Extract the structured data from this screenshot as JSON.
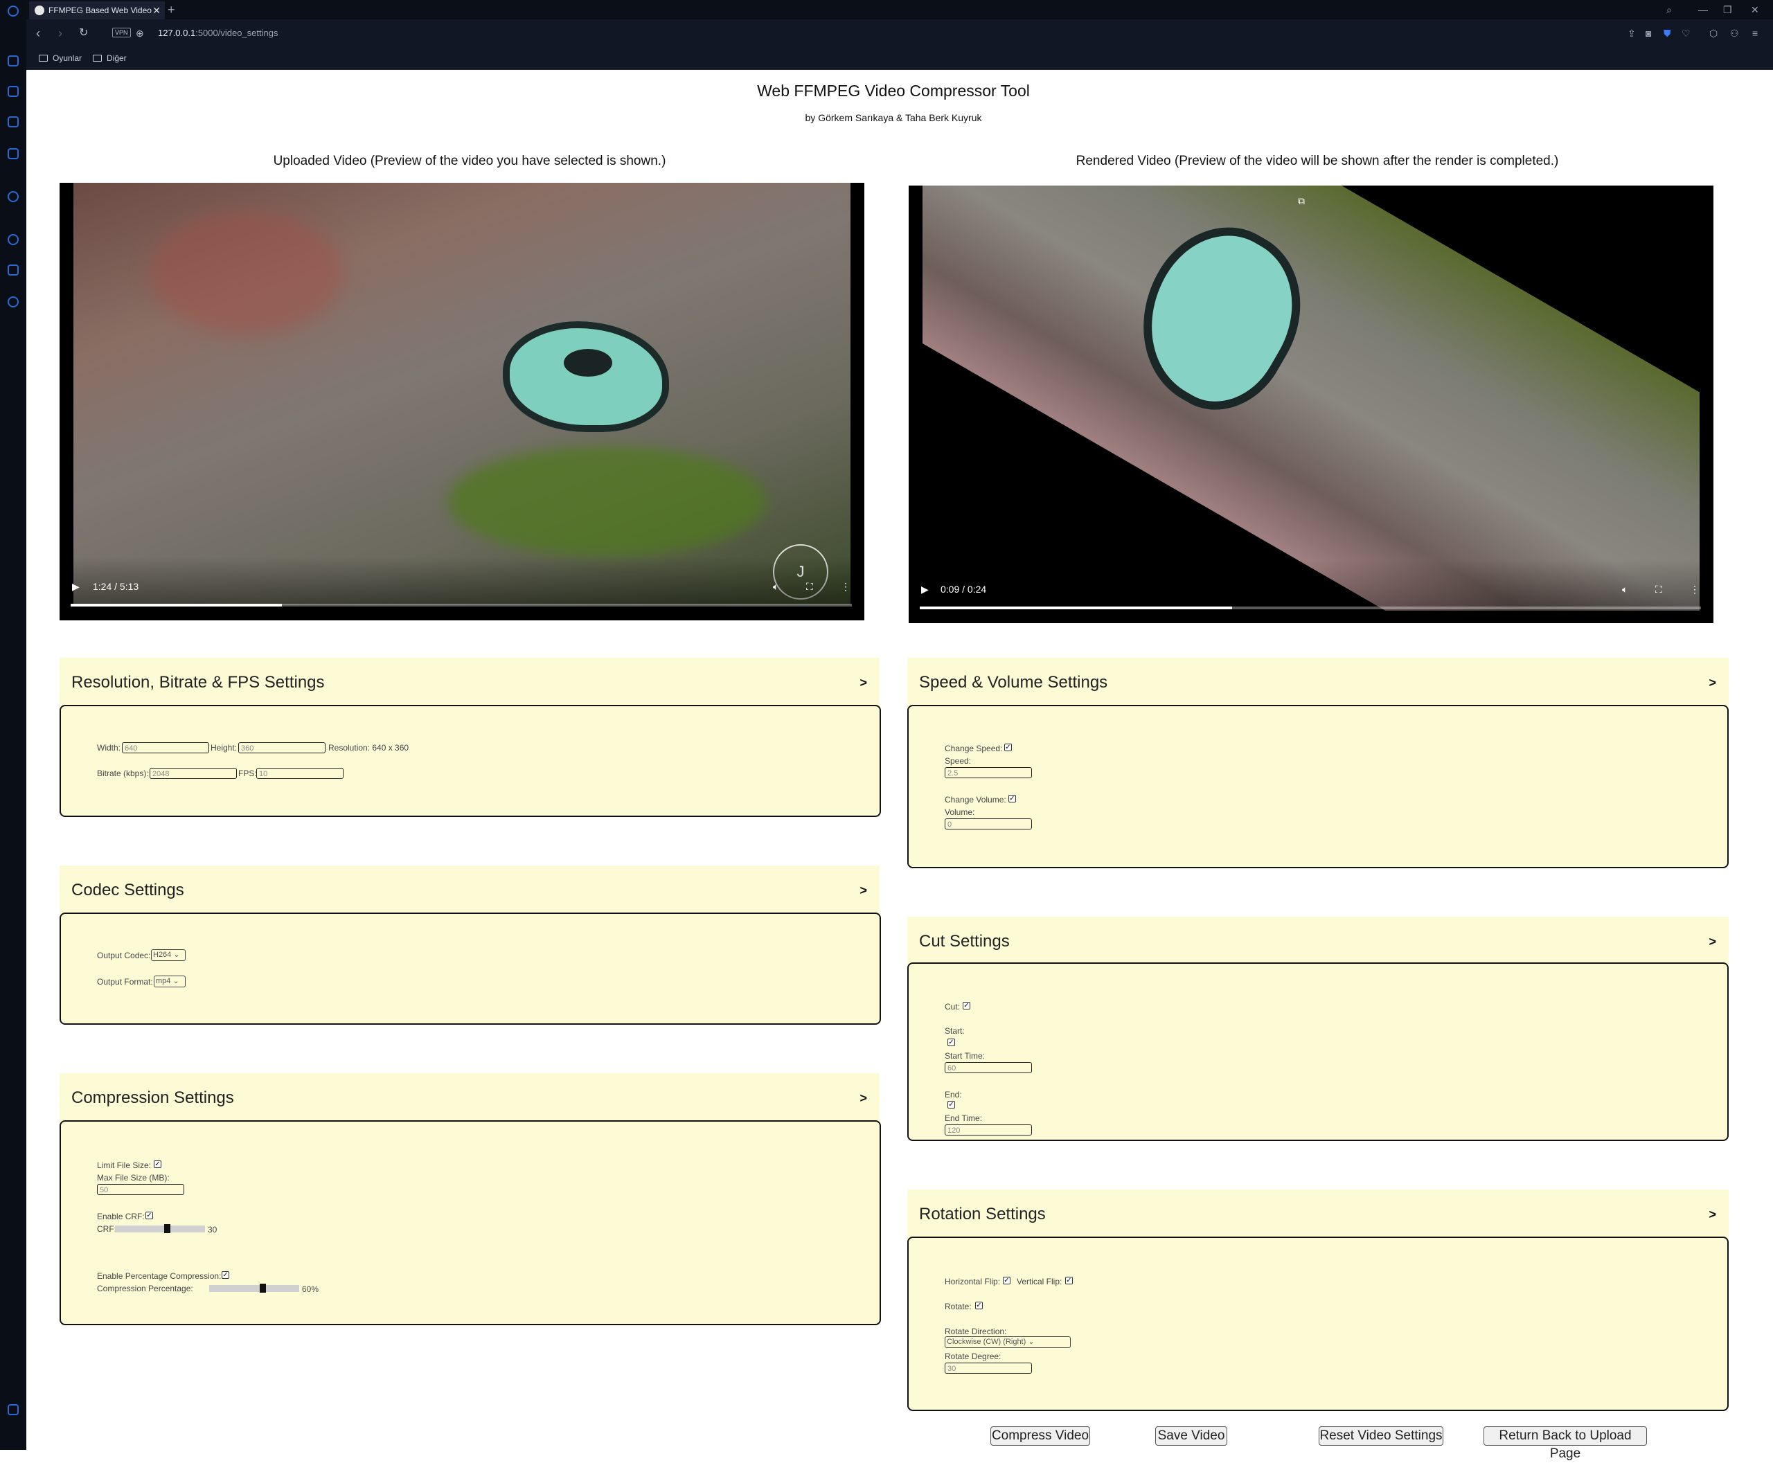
{
  "browser": {
    "tab_title": "FFMPEG Based Web Video",
    "url_host": "127.0.0.1",
    "url_path": ":5000/video_settings",
    "vpn_label": "VPN",
    "bookmarks": [
      "Oyunlar",
      "Diğer"
    ]
  },
  "page": {
    "title": "Web FFMPEG Video Compressor Tool",
    "subtitle": "by Görkem Sarıkaya & Taha Berk Kuyruk"
  },
  "videos": {
    "uploaded": {
      "label": "Uploaded Video (Preview of the video you have selected is shown.)",
      "time": "1:24 / 5:13",
      "progress": 0.27
    },
    "rendered": {
      "label": "Rendered Video (Preview of the video will be shown after the render is completed.)",
      "time": "0:09 / 0:24",
      "progress": 0.4
    }
  },
  "resolution": {
    "title": "Resolution, Bitrate & FPS Settings",
    "width_label": "Width:",
    "width_value": "640",
    "height_label": "Height:",
    "height_value": "360",
    "resolution_text": "Resolution: 640 x 360",
    "bitrate_label": "Bitrate (kbps):",
    "bitrate_value": "2048",
    "fps_label": "FPS:",
    "fps_value": "10"
  },
  "codec": {
    "title": "Codec Settings",
    "codec_label": "Output Codec:",
    "codec_value": "H264",
    "format_label": "Output Format:",
    "format_value": "mp4"
  },
  "compression": {
    "title": "Compression Settings",
    "limit_label": "Limit File Size:",
    "max_label": "Max File Size (MB):",
    "max_value": "50",
    "crf_enable_label": "Enable CRF:",
    "crf_label": "CRF:",
    "crf_value": "30",
    "pct_enable_label": "Enable Percentage Compression:",
    "pct_label": "Compression Percentage:",
    "pct_value": "60%"
  },
  "speed": {
    "title": "Speed & Volume Settings",
    "change_speed_label": "Change Speed:",
    "speed_label": "Speed:",
    "speed_value": "2.5",
    "change_volume_label": "Change Volume:",
    "volume_label": "Volume:",
    "volume_value": "0"
  },
  "cut": {
    "title": "Cut Settings",
    "cut_label": "Cut:",
    "start_label": "Start:",
    "start_time_label": "Start Time:",
    "start_time_value": "60",
    "end_label": "End:",
    "end_time_label": "End Time:",
    "end_time_value": "120"
  },
  "rotation": {
    "title": "Rotation Settings",
    "hflip_label": "Horizontal Flip:",
    "vflip_label": "Vertical Flip:",
    "rotate_label": "Rotate:",
    "direction_label": "Rotate Direction:",
    "direction_value": "Clockwise (CW) (Right)",
    "degree_label": "Rotate Degree:",
    "degree_value": "30"
  },
  "buttons": {
    "compress": "Compress Video",
    "save": "Save Video",
    "reset": "Reset Video Settings",
    "return": "Return Back to Upload Page"
  },
  "chevron": ">",
  "checkmark": "✓"
}
